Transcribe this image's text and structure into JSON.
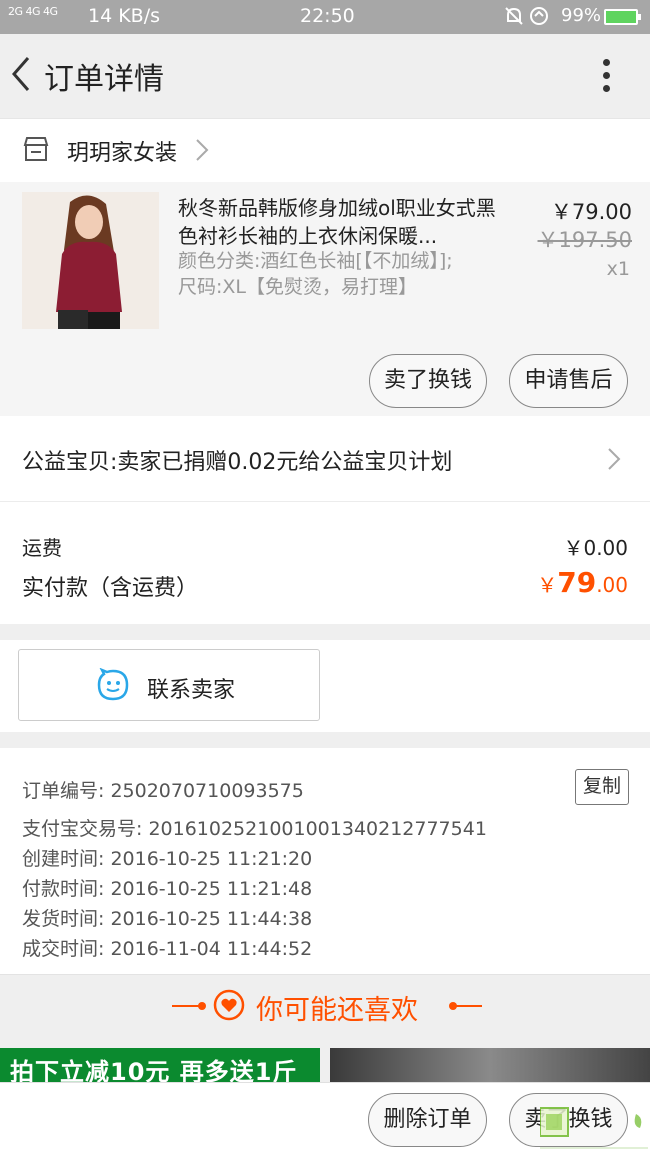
{
  "status_bar": {
    "signal_text": "2G 4G 4G",
    "speed": "14 KB/s",
    "time": "22:50",
    "battery": "99%"
  },
  "title_bar": {
    "title": "订单详情"
  },
  "shop": {
    "name": "玥玥家女装"
  },
  "product": {
    "title": "秋冬新品韩版修身加绒ol职业女式黑色衬衫长袖的上衣休闲保暖...",
    "spec": "颜色分类:酒红色长袖[【不加绒】];尺码:XL【免熨烫，易打理】",
    "price": "￥79.00",
    "original_price": "￥197.50",
    "quantity": "x1",
    "sell_button": "卖了换钱",
    "aftersale_button": "申请售后"
  },
  "charity": {
    "text": "公益宝贝:卖家已捐赠0.02元给公益宝贝计划"
  },
  "fees": {
    "shipping_label": "运费",
    "shipping_value": "￥0.00",
    "paid_label": "实付款（含运费）",
    "paid_currency": "￥",
    "paid_integer": "79",
    "paid_decimal": ".00"
  },
  "contact": {
    "label": "联系卖家"
  },
  "order_info": {
    "order_no": "订单编号: 2502070710093575",
    "alipay_no": "支付宝交易号: 2016102521001001340212777541",
    "created": "创建时间: 2016-10-25 11:21:20",
    "paid": "付款时间: 2016-10-25 11:21:48",
    "shipped": "发货时间: 2016-10-25 11:44:38",
    "completed": "成交时间: 2016-11-04 11:44:52",
    "copy_button": "复制"
  },
  "recommend": {
    "title": "你可能还喜欢",
    "banner_text": "拍下立减10元 再多送1斤"
  },
  "bottom_bar": {
    "delete_button": "删除订单",
    "sell_button": "卖了换钱"
  },
  "colors": {
    "accent": "#ff5000",
    "status_bar": "#a7a7a7",
    "background": "#efefef"
  }
}
